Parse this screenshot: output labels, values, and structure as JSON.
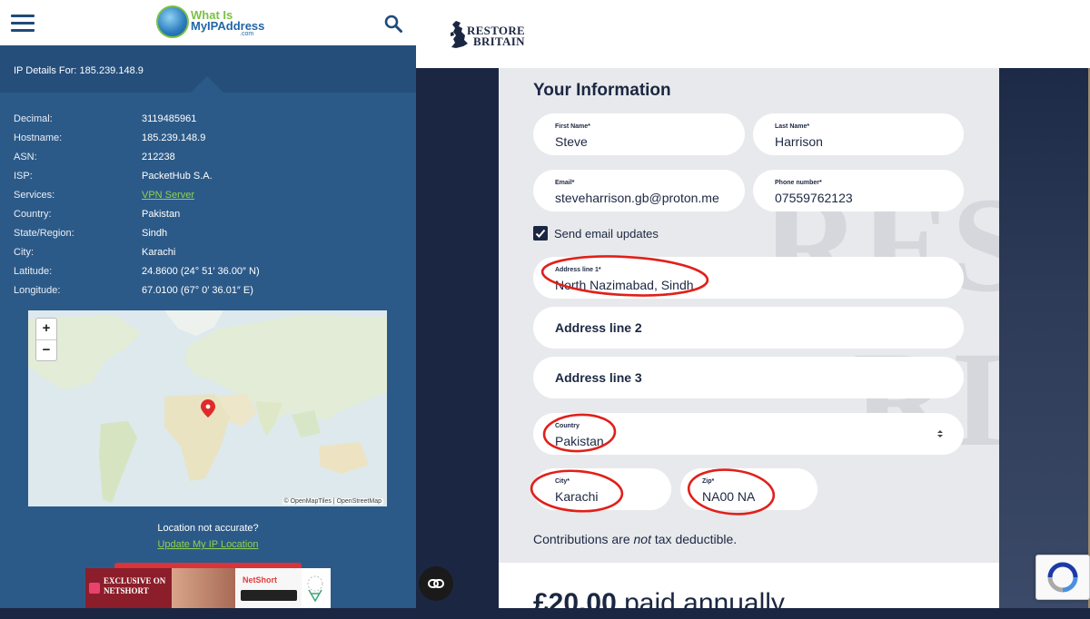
{
  "ip_panel": {
    "logo_line1": "What Is",
    "logo_line2": "MyIPAddress",
    "logo_line3": ".com",
    "ip_heading": "IP Details For: 185.239.148.9",
    "details": [
      {
        "key": "Decimal:",
        "value": "3119485961"
      },
      {
        "key": "Hostname:",
        "value": "185.239.148.9"
      },
      {
        "key": "ASN:",
        "value": "212238"
      },
      {
        "key": "ISP:",
        "value": "PacketHub S.A."
      },
      {
        "key": "Services:",
        "value": "VPN Server"
      },
      {
        "key": "Country:",
        "value": "Pakistan"
      },
      {
        "key": "State/Region:",
        "value": "Sindh"
      },
      {
        "key": "City:",
        "value": "Karachi"
      },
      {
        "key": "Latitude:",
        "value": "24.8600 (24° 51′ 36.00″ N)"
      },
      {
        "key": "Longitude:",
        "value": "67.0100 (67° 0′ 36.01″ E)"
      }
    ],
    "map": {
      "zoom_in": "+",
      "zoom_out": "−",
      "attribution": "© OpenMapTiles | OpenStreetMap"
    },
    "location_question": "Location not accurate?",
    "location_link": "Update My IP Location",
    "ad": {
      "headline_line1": "EXCLUSIVE ON",
      "headline_line2": "NETSHORT",
      "brand": "NetShort"
    }
  },
  "restore_britain": {
    "logo_line1": "RESTORE",
    "logo_line2": "BRITAIN",
    "section_title": "Your Information",
    "fields": {
      "first_name": {
        "label": "First Name*",
        "value": "Steve"
      },
      "last_name": {
        "label": "Last Name*",
        "value": "Harrison"
      },
      "email": {
        "label": "Email*",
        "value": "steveharrison.gb@proton.me"
      },
      "phone": {
        "label": "Phone number*",
        "value": "07559762123"
      },
      "address1": {
        "label": "Address line 1*",
        "value": "North Nazimabad, Sindh"
      },
      "address2": {
        "placeholder": "Address line 2"
      },
      "address3": {
        "placeholder": "Address line 3"
      },
      "country": {
        "label": "Country",
        "value": "Pakistan"
      },
      "city": {
        "label": "City*",
        "value": "Karachi"
      },
      "zip": {
        "label": "Zip*",
        "value": "NA00 NA"
      }
    },
    "email_updates_label": "Send email updates",
    "email_updates_checked": true,
    "note_before": "Contributions are ",
    "note_em": "not",
    "note_after": " tax deductible.",
    "price_amount": "£20.00",
    "price_period": " paid annually",
    "background_letters_line1": "REST",
    "background_letters_line2": "RIT"
  },
  "colors": {
    "navy": "#1b2742",
    "ip_blue": "#2c5a88",
    "link_green": "#8fd14f",
    "annotation_red": "#e0201a"
  }
}
